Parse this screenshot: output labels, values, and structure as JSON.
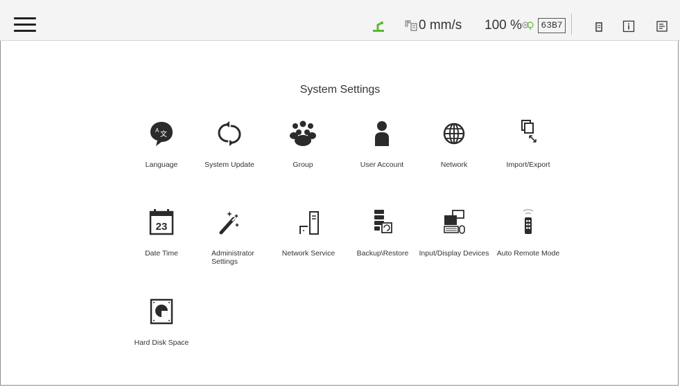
{
  "topbar": {
    "speed": "0 mm/s",
    "percent": "100 %",
    "code": "63B7"
  },
  "page": {
    "title": "System Settings"
  },
  "tiles": [
    {
      "label": "Language",
      "icon": "language-icon"
    },
    {
      "label": "System Update",
      "icon": "system-update-icon"
    },
    {
      "label": "Group",
      "icon": "group-icon"
    },
    {
      "label": "User Account",
      "icon": "user-account-icon"
    },
    {
      "label": "Network",
      "icon": "network-globe-icon"
    },
    {
      "label": "Import/Export",
      "icon": "import-export-icon"
    },
    {
      "label": "Date Time",
      "icon": "calendar-icon",
      "day": "23"
    },
    {
      "label": "Administrator Settings",
      "icon": "magic-wand-icon"
    },
    {
      "label": "Network Service",
      "icon": "network-service-icon"
    },
    {
      "label": "Backup\\Restore",
      "icon": "backup-restore-icon"
    },
    {
      "label": "Input/Display Devices",
      "icon": "computer-devices-icon"
    },
    {
      "label": "Auto Remote Mode",
      "icon": "remote-control-icon"
    },
    {
      "label": "Hard Disk Space",
      "icon": "hard-disk-icon"
    }
  ],
  "colors": {
    "accent_green": "#5cb82e",
    "icon_dark": "#2b2b2b"
  }
}
